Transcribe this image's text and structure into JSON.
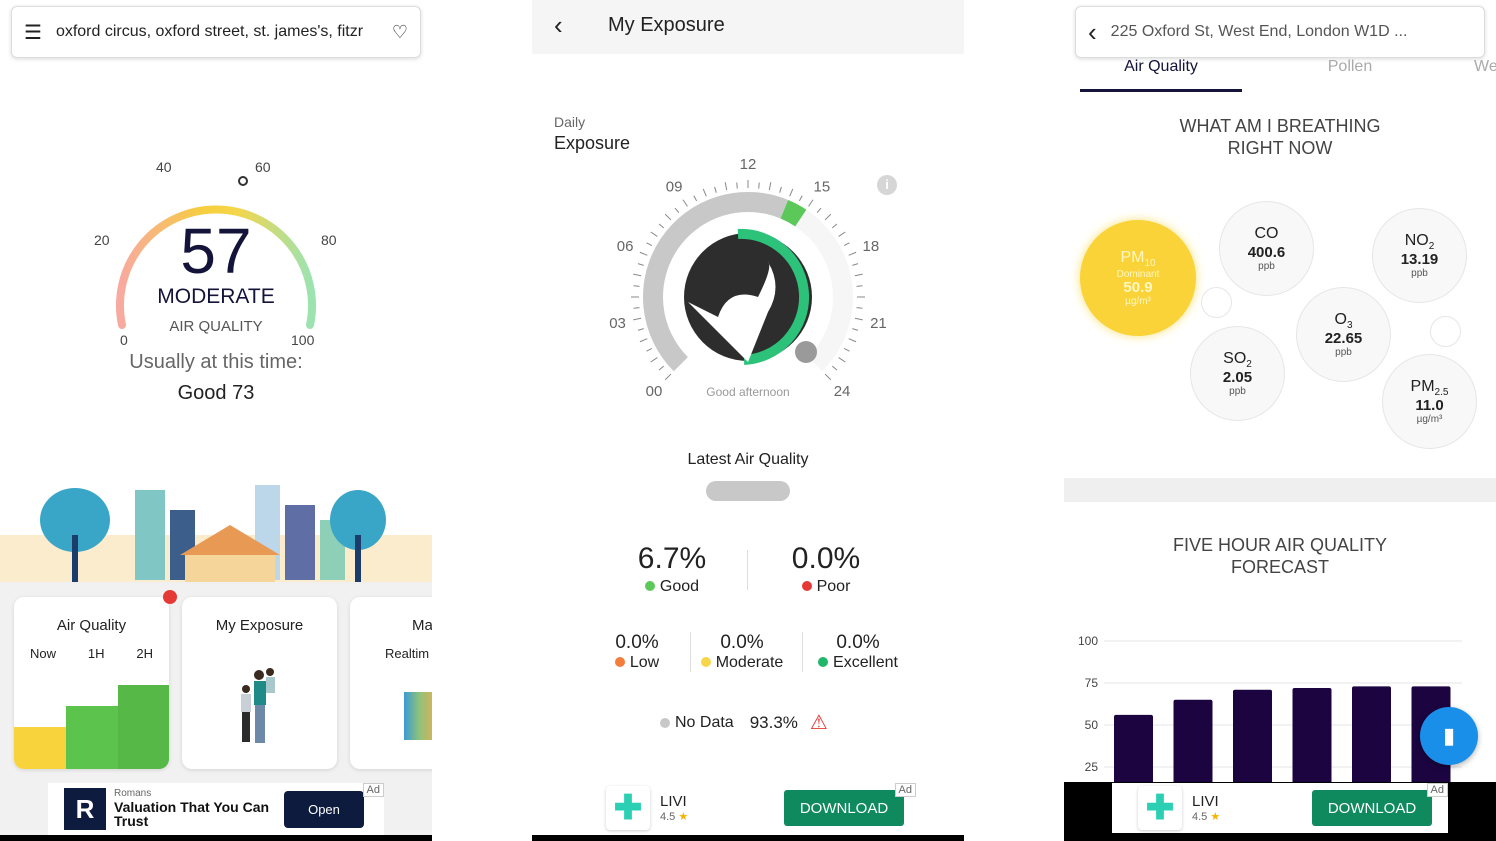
{
  "panel1": {
    "search": {
      "value": "oxford circus, oxford street, st. james's, fitzr",
      "menu_icon": "hamburger-icon",
      "fav_icon": "heart-outline-icon"
    },
    "gauge": {
      "value": "57",
      "level": "MODERATE",
      "label": "AIR QUALITY",
      "ticks": [
        "0",
        "20",
        "40",
        "60",
        "80",
        "100"
      ],
      "aqi": 57
    },
    "usual": {
      "label": "Usually at this time:",
      "value": "Good 73"
    },
    "cards": [
      {
        "title": "Air Quality",
        "cols": [
          "Now",
          "1H",
          "2H"
        ],
        "levels": [
          57,
          73,
          73
        ]
      },
      {
        "title": "My Exposure"
      },
      {
        "title": "Ma",
        "subtitle": "Realtim"
      }
    ],
    "ad": {
      "brand": "Romans",
      "headline": "Valuation That You Can Trust",
      "button": "Open",
      "tag": "Ad"
    }
  },
  "panel2": {
    "header": {
      "title": "My Exposure",
      "back_icon": "chevron-left-icon"
    },
    "section": {
      "line1": "Daily",
      "line2": "Exposure"
    },
    "clock_labels": [
      "00",
      "03",
      "06",
      "09",
      "12",
      "15",
      "18",
      "21",
      "24"
    ],
    "greeting": "Good afternoon",
    "latest": "Latest Air Quality",
    "stats_top": [
      {
        "value": "6.7%",
        "label": "Good",
        "color": "#5cc85a"
      },
      {
        "value": "0.0%",
        "label": "Poor",
        "color": "#e53935"
      }
    ],
    "stats_mid": [
      {
        "value": "0.0%",
        "label": "Low",
        "color": "#f47c3c"
      },
      {
        "value": "0.0%",
        "label": "Moderate",
        "color": "#f7d64a"
      },
      {
        "value": "0.0%",
        "label": "Excellent",
        "color": "#22b66a"
      }
    ],
    "nodata": {
      "label": "No Data",
      "value": "93.3%",
      "color": "#c8c8c8"
    },
    "ad": {
      "name": "LIVI",
      "rating": "4.5",
      "button": "DOWNLOAD",
      "tag": "Ad"
    }
  },
  "panel3": {
    "header": {
      "address": "225 Oxford St, West End, London W1D ...",
      "back_icon": "chevron-left-icon"
    },
    "tabs": [
      {
        "label": "Air Quality",
        "active": true
      },
      {
        "label": "Pollen"
      },
      {
        "label": "We"
      }
    ],
    "breathing_title": "WHAT AM I BREATHING RIGHT NOW",
    "pollutants": [
      {
        "name": "PM",
        "sub": "10",
        "extra": "Dominant",
        "value": "50.9",
        "unit": "µg/m³"
      },
      {
        "name": "CO",
        "sub": "",
        "value": "400.6",
        "unit": "ppb"
      },
      {
        "name": "NO",
        "sub": "2",
        "value": "13.19",
        "unit": "ppb"
      },
      {
        "name": "O",
        "sub": "3",
        "value": "22.65",
        "unit": "ppb"
      },
      {
        "name": "SO",
        "sub": "2",
        "value": "2.05",
        "unit": "ppb"
      },
      {
        "name": "PM",
        "sub": "2.5",
        "value": "11.0",
        "unit": "µg/m³"
      }
    ],
    "forecast_title": "FIVE HOUR AIR QUALITY FORECAST",
    "chart_data": {
      "type": "bar",
      "values": [
        56,
        65,
        71,
        72,
        73,
        73
      ],
      "yticks": [
        "25",
        "50",
        "75",
        "100"
      ],
      "ylim": [
        0,
        100
      ],
      "color": "#1b0440",
      "grid": true
    },
    "fab_icon": "map-icon",
    "ad": {
      "name": "LIVI",
      "rating": "4.5",
      "button": "DOWNLOAD",
      "tag": "Ad"
    }
  }
}
